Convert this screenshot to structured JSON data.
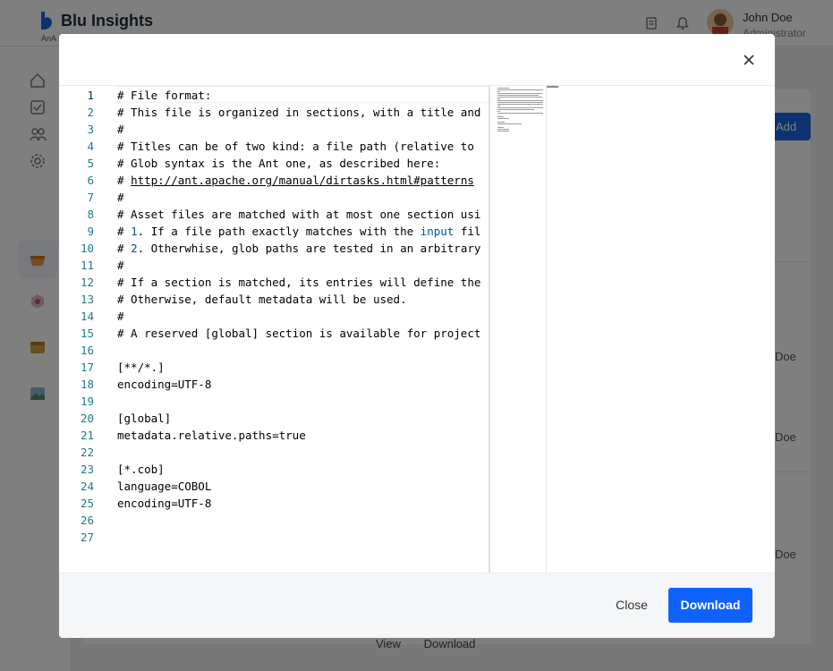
{
  "app": {
    "brand_name": "Blu Insights",
    "brand_sub": "AnA",
    "user": {
      "name": "John Doe",
      "role": "Administrator"
    },
    "add_button_label": "Add",
    "list_user_names": [
      "Doe",
      "Doe",
      "Doe"
    ],
    "bottom_actions": [
      "View",
      "Download"
    ],
    "colors": {
      "accent": "#1c63e1",
      "download": "#0f62fe"
    }
  },
  "modal": {
    "close_icon": "close-icon",
    "editor": {
      "current_line": 1,
      "line_numbers": [
        "1",
        "2",
        "3",
        "4",
        "5",
        "6",
        "7",
        "8",
        "9",
        "10",
        "11",
        "12",
        "13",
        "14",
        "15",
        "16",
        "17",
        "18",
        "19",
        "20",
        "21",
        "22",
        "23",
        "24",
        "25",
        "26",
        "27"
      ],
      "lines": [
        "# File format:",
        "# This file is organized in sections, with a title and",
        "#",
        "# Titles can be of two kind: a file path (relative to",
        "# Glob syntax is the Ant one, as described here:",
        "# http://ant.apache.org/manual/dirtasks.html#patterns",
        "#",
        "# Asset files are matched with at most one section usi",
        "# 1. If a file path exactly matches with the input fil",
        "# 2. Otherwhise, glob paths are tested in an arbitrary",
        "#",
        "# If a section is matched, its entries will define the",
        "# Otherwise, default metadata will be used.",
        "#",
        "# A reserved [global] section is available for project",
        "",
        "[**/*.]",
        "encoding=UTF-8",
        "",
        "[global]",
        "metadata.relative.paths=true",
        "",
        "[*.cob]",
        "language=COBOL",
        "encoding=UTF-8",
        "",
        ""
      ],
      "segments": {
        "line6_prefix": "# ",
        "line6_link": "http://ant.apache.org/manual/dirtasks.html#patterns",
        "line9_num": "1",
        "line9_keyword": "input",
        "line10_num": "2"
      }
    },
    "footer": {
      "close_label": "Close",
      "download_label": "Download"
    }
  }
}
